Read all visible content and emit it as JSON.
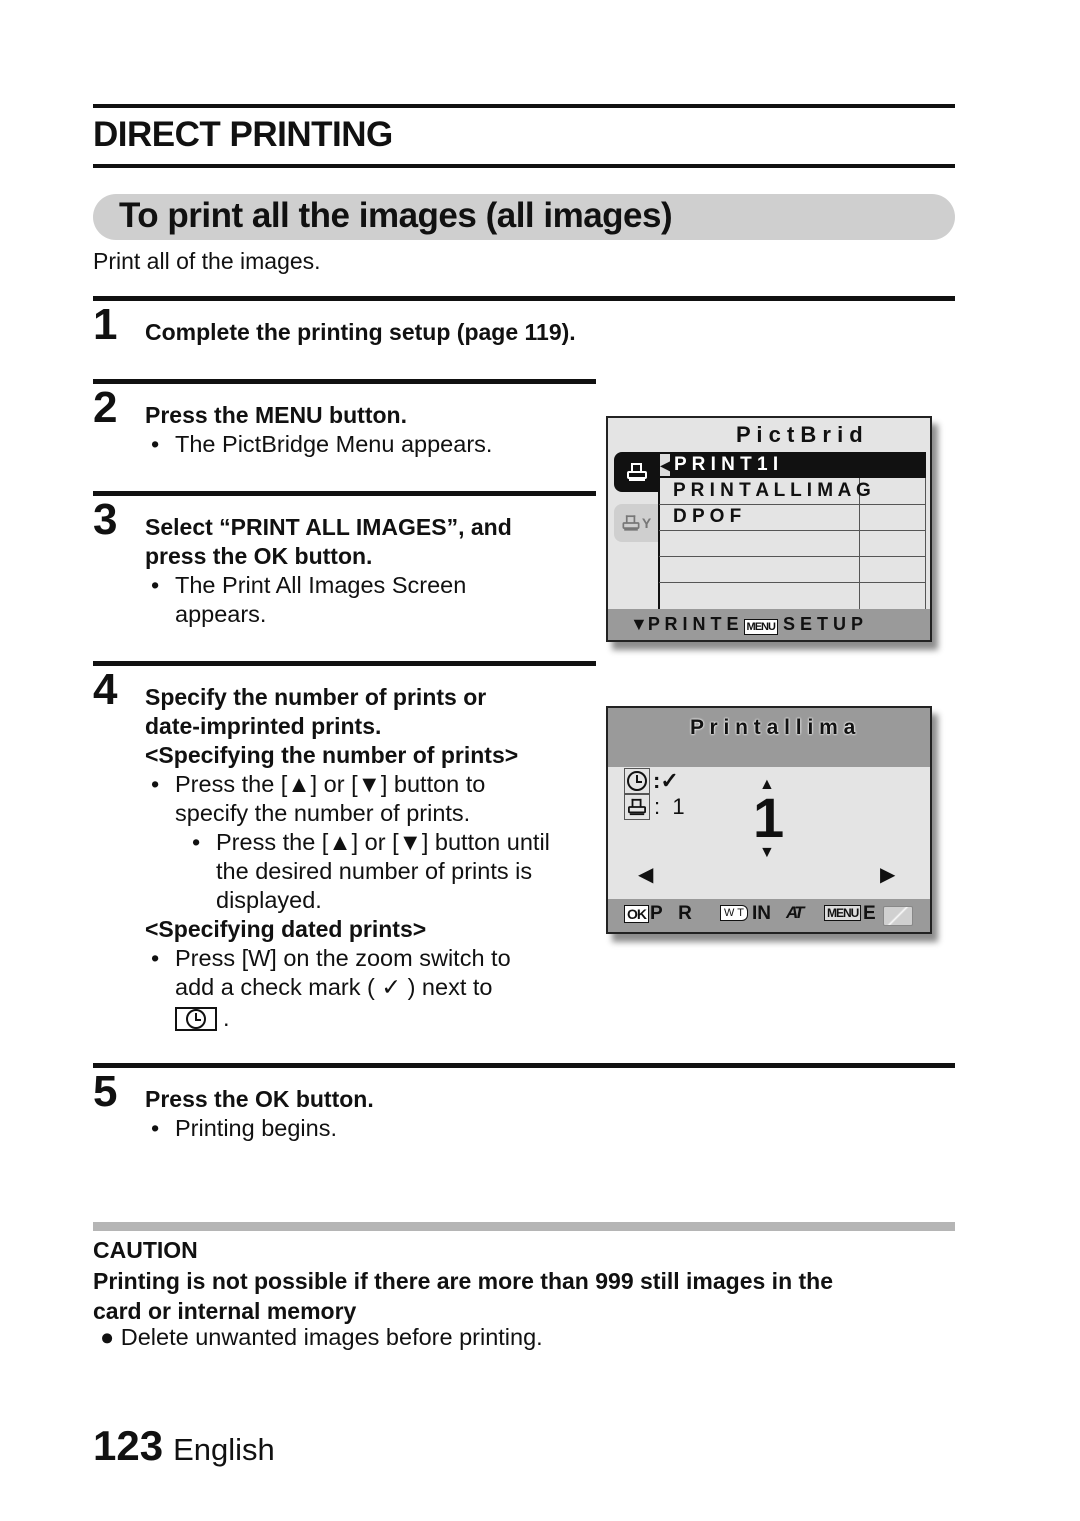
{
  "header": {
    "section_title": "DIRECT PRINTING",
    "subsection_title": "To print all the images (all images)",
    "intro": "Print all of the images."
  },
  "steps": [
    {
      "number": "1",
      "heading": "Complete the printing setup (page 119).",
      "bullets": []
    },
    {
      "number": "2",
      "heading": "Press the MENU button.",
      "bullets": [
        "The PictBridge Menu appears."
      ]
    },
    {
      "number": "3",
      "heading_line1": "Select “PRINT ALL IMAGES”, and",
      "heading_line2": "press the OK button.",
      "bullets": [
        "The Print All Images Screen",
        "appears."
      ]
    },
    {
      "number": "4",
      "heading_line1": "Specify the number of prints or",
      "heading_line2": "date-imprinted prints.",
      "sub1_heading": "<Specifying the number of prints>",
      "sub1_bullet_line1": "Press the [▲] or [▼] button to",
      "sub1_bullet_line2": "specify the number of prints.",
      "sub1_nested_line1": "Press the [▲] or [▼] button until",
      "sub1_nested_line2": "the desired number of prints is",
      "sub1_nested_line3": "displayed.",
      "sub2_heading": "<Specifying dated prints>",
      "sub2_bullet_line1": "Press [W] on the zoom switch to",
      "sub2_bullet_line2": "add a check mark ( ✓ ) next to",
      "sub2_bullet_line3_suffix": "."
    },
    {
      "number": "5",
      "heading": "Press the OK button.",
      "bullets": [
        "Printing begins."
      ]
    }
  ],
  "pictbridge_menu_screen": {
    "title": "P  i  c  t  B  r  i  d",
    "tabs": [
      {
        "icon": "printer-icon",
        "active": true
      },
      {
        "icon": "printer-settings-icon",
        "active": false
      }
    ],
    "items": [
      {
        "label": "P  R  I  N  T  1  I",
        "selected": true
      },
      {
        "label": "P  R  I  N  T  A  L  L  I  M  A  G",
        "selected": false
      },
      {
        "label": "D  P  O  F",
        "selected": false
      },
      {
        "label": "",
        "selected": false
      },
      {
        "label": "",
        "selected": false
      },
      {
        "label": "",
        "selected": false
      }
    ],
    "footer_arrow": "▼",
    "footer_text_left": "P  R  I  N  T  E",
    "footer_menu_badge": "MENU",
    "footer_text_right": "S  E  T  U  P"
  },
  "print_all_screen": {
    "title": "P  r  i  n  t  a  l  l  i  m  a",
    "date_label": ":✓",
    "copies_label": ":  1",
    "count_value": "1",
    "up_arrow": "▲",
    "down_arrow": "▼",
    "left_arrow": "◀",
    "right_arrow": "▶",
    "footer": {
      "ok_badge": "OK",
      "print_text": "P   R",
      "w_badge": "W T",
      "in_text": "IN",
      "at_text": "AT",
      "menu_badge": "MENU",
      "end_text": "E"
    }
  },
  "caution": {
    "title": "CAUTION",
    "heading_line1": "Printing is not possible if there are more than 999 still images in the",
    "heading_line2": "card or internal memory",
    "bullet": "Delete unwanted images before printing."
  },
  "footer": {
    "page_number": "123",
    "language": "English"
  }
}
